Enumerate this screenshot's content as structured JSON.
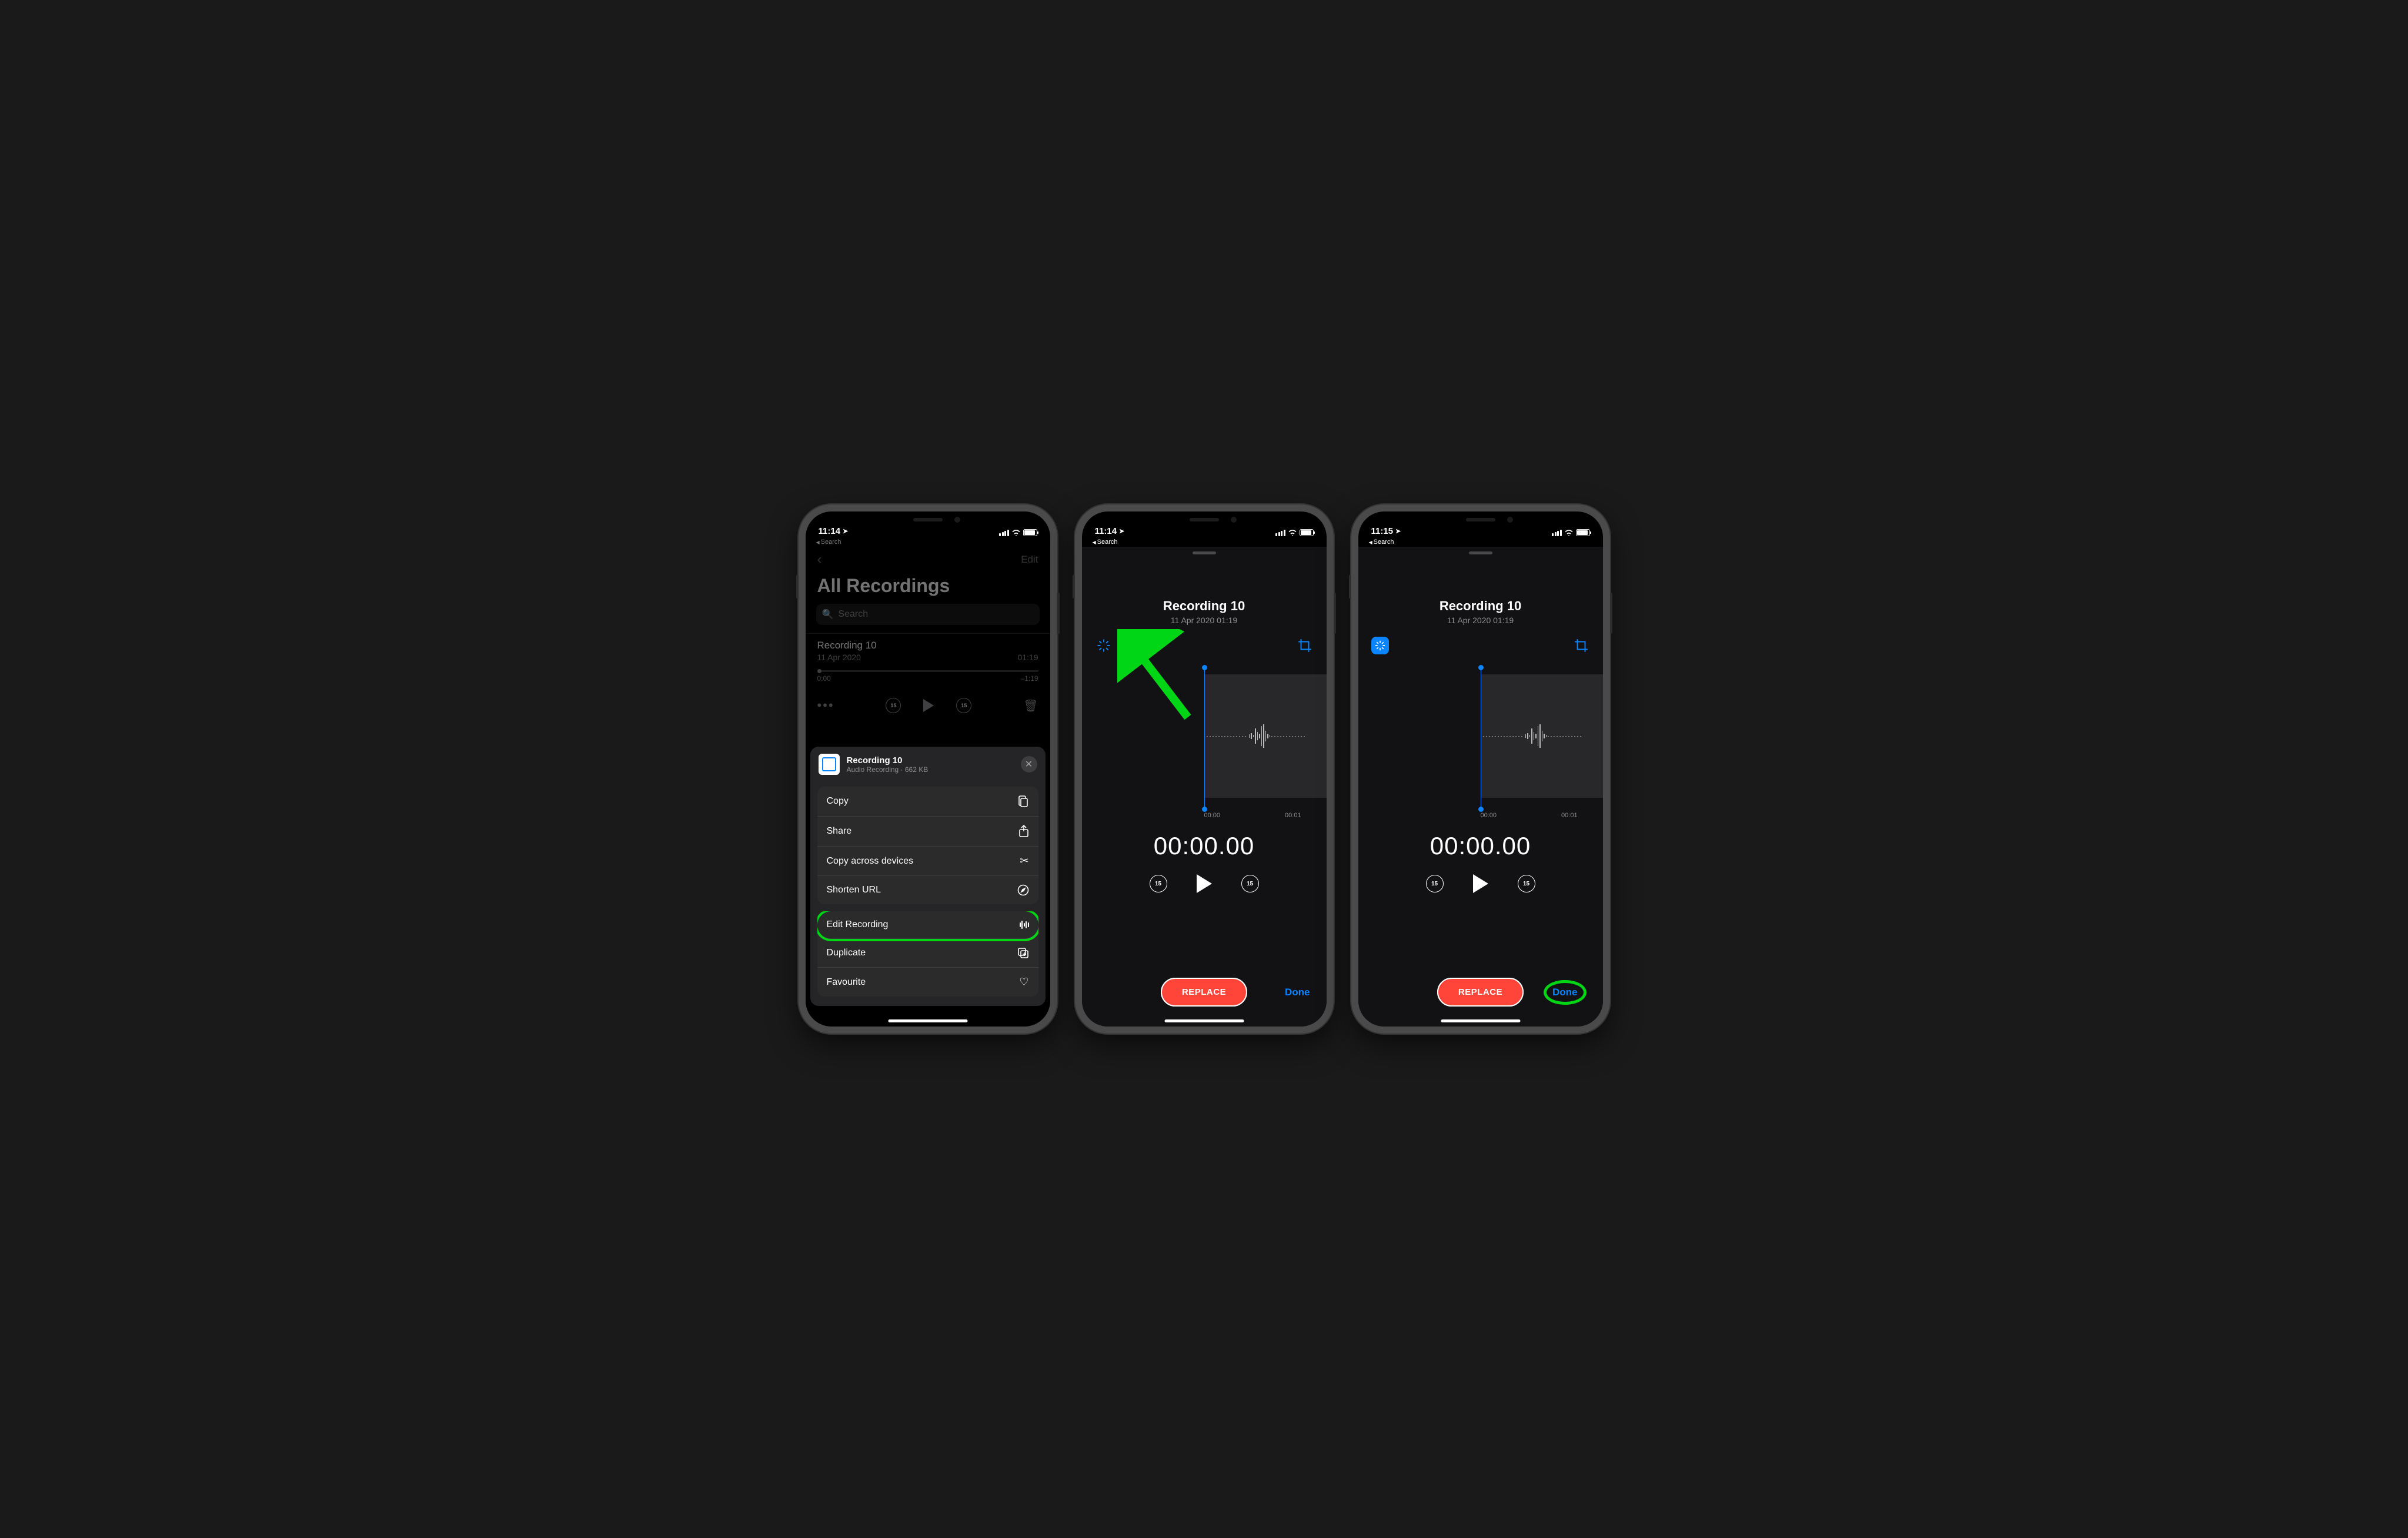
{
  "status": {
    "time1": "11:14",
    "time2": "11:14",
    "time3": "11:15",
    "back_app": "Search"
  },
  "screen1": {
    "edit_label": "Edit",
    "page_title": "All Recordings",
    "search_placeholder": "Search",
    "recording": {
      "name": "Recording 10",
      "date": "11 Apr 2020",
      "duration": "01:19",
      "start_time": "0:00",
      "end_time": "–1:19"
    },
    "share": {
      "title": "Recording 10",
      "subtitle": "Audio Recording · 662 KB",
      "items_top": [
        {
          "label": "Copy",
          "icon": "copy"
        },
        {
          "label": "Share",
          "icon": "share"
        },
        {
          "label": "Copy across devices",
          "icon": "scissors"
        },
        {
          "label": "Shorten URL",
          "icon": "compass"
        }
      ],
      "items_bottom": [
        {
          "label": "Edit Recording",
          "icon": "wave",
          "highlighted": true
        },
        {
          "label": "Duplicate",
          "icon": "duplicate"
        },
        {
          "label": "Favourite",
          "icon": "heart"
        }
      ]
    }
  },
  "editor": {
    "title": "Recording 10",
    "subtitle": "11 Apr 2020  01:19",
    "tick0": "00:00",
    "tick1": "00:01",
    "current_time": "00:00.00",
    "replace_label": "REPLACE",
    "done_label": "Done"
  }
}
